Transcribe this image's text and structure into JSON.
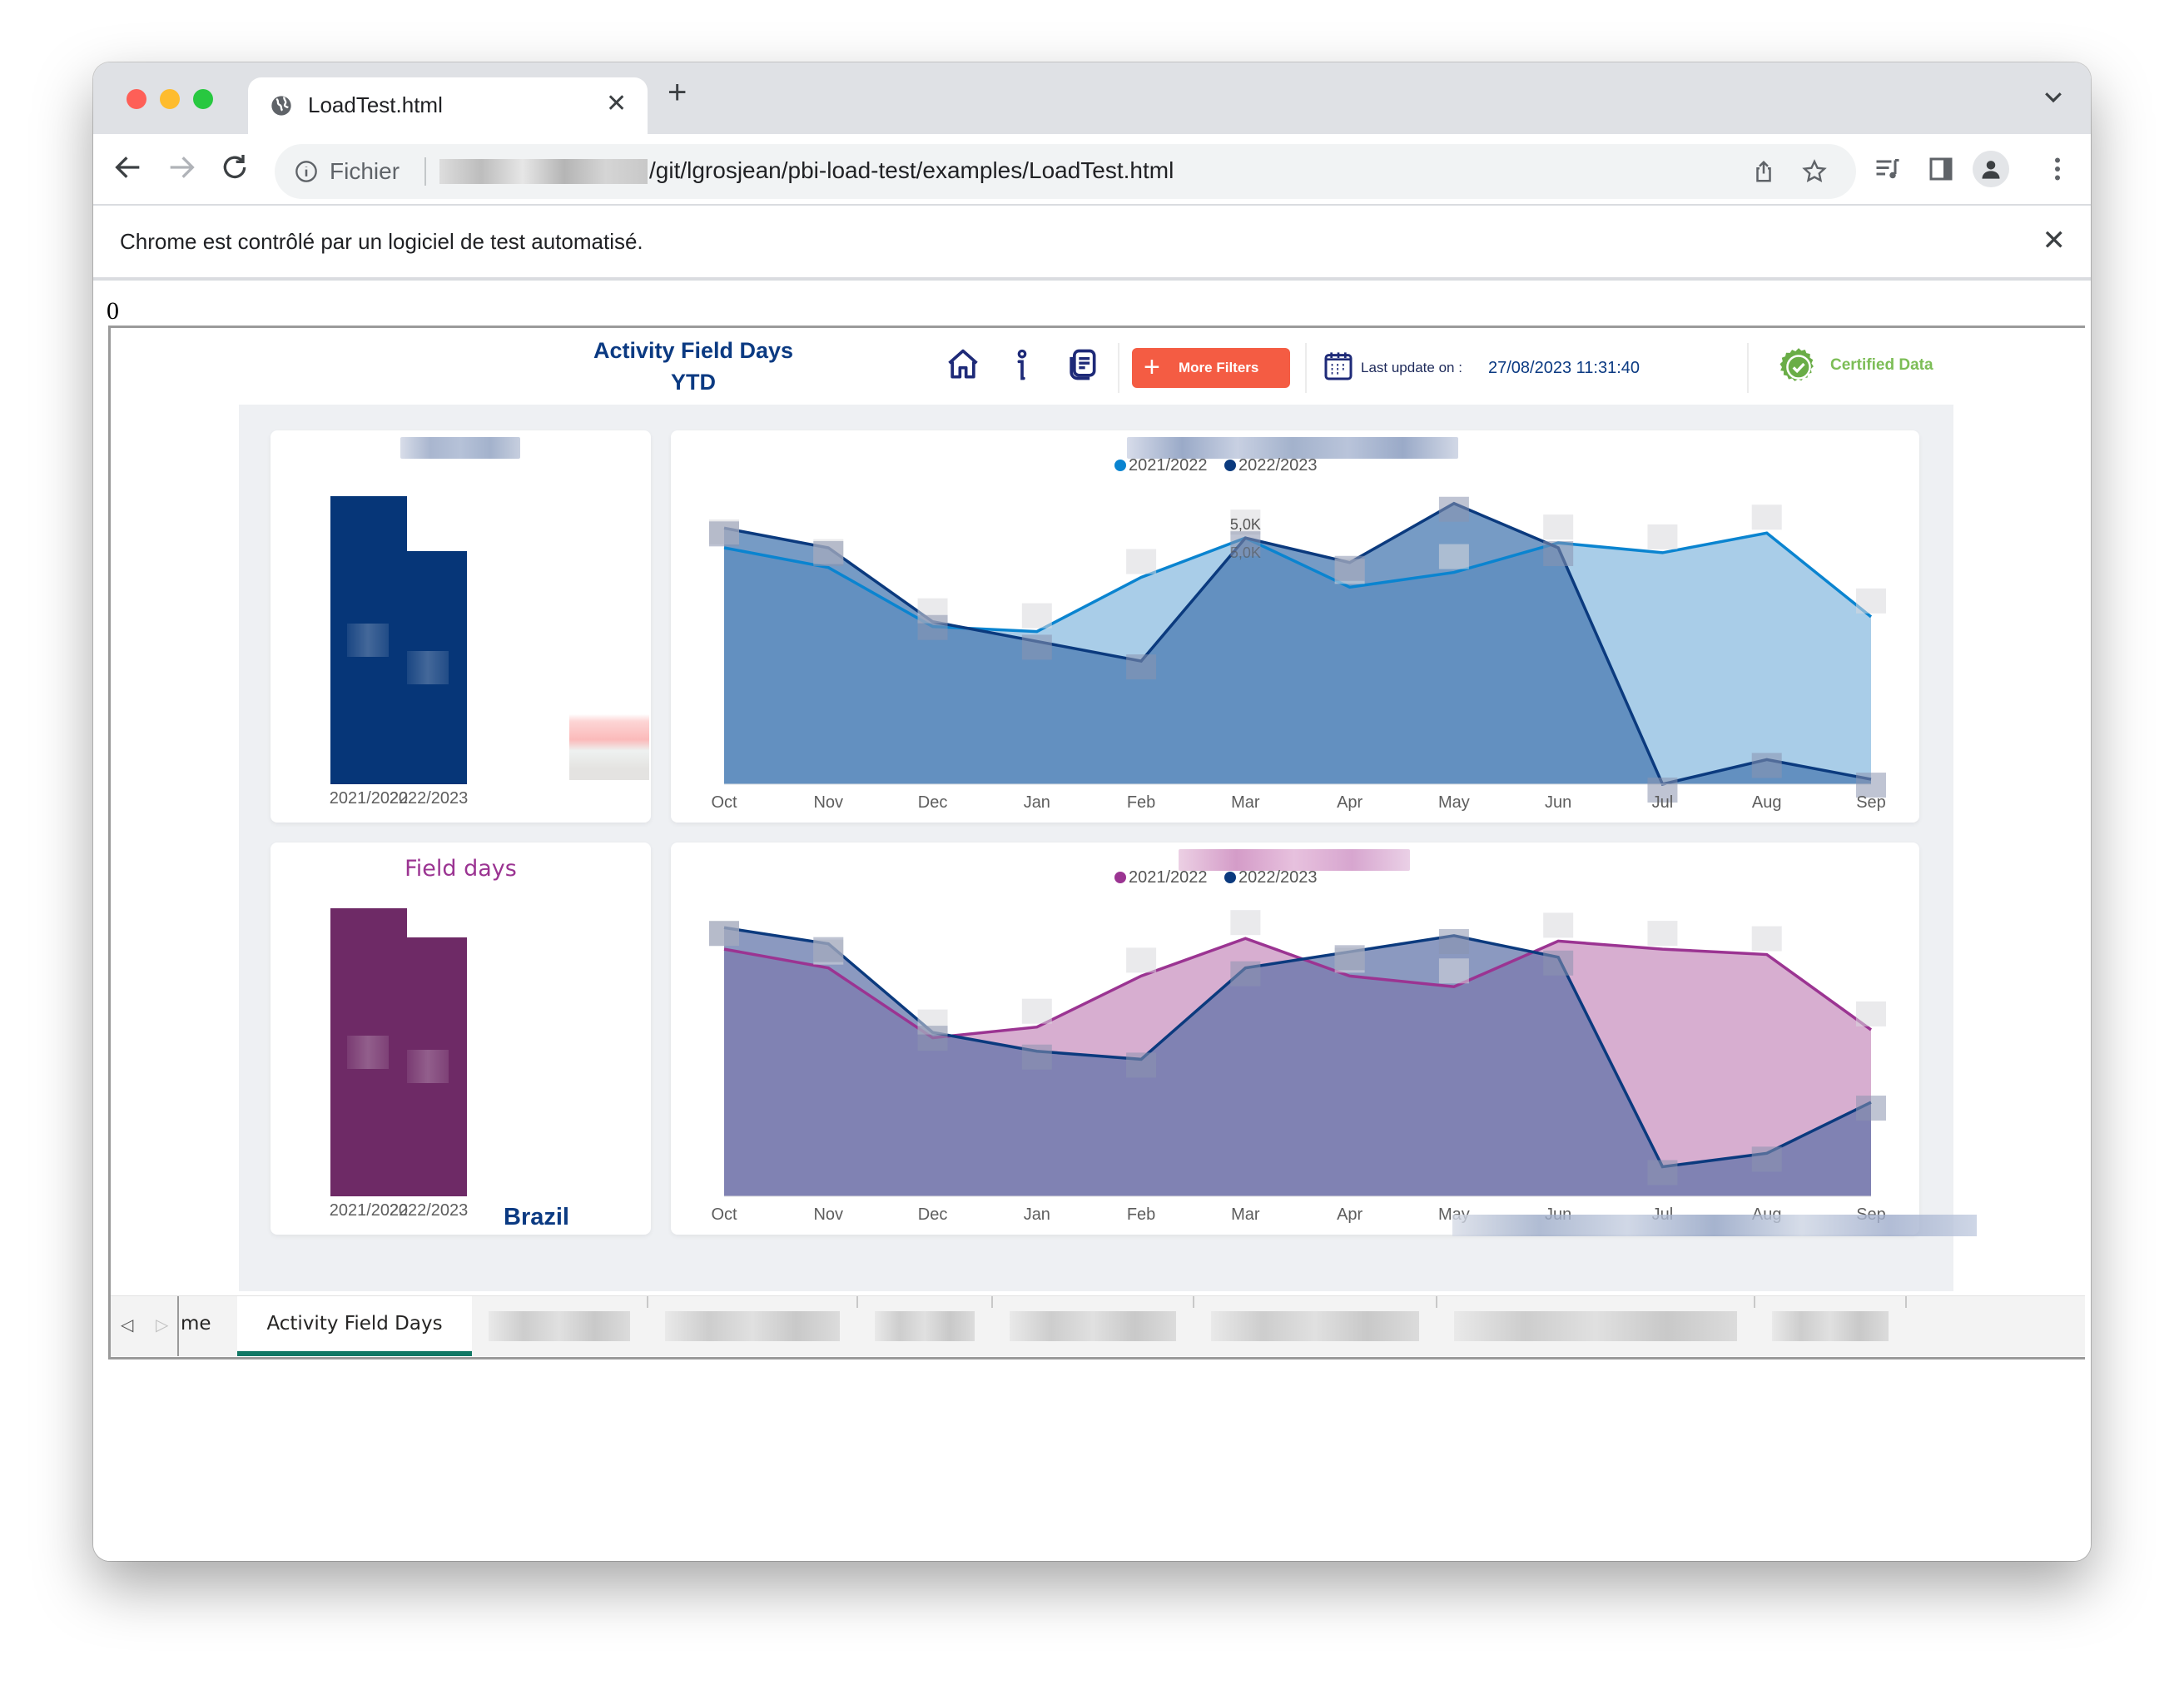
{
  "browser": {
    "tab_title": "LoadTest.html",
    "new_tab_symbol": "+",
    "close_symbol": "✕",
    "scheme_label": "Fichier",
    "url_visible": "/git/lgrosjean/pbi-load-test/examples/LoadTest.html",
    "infobar_message": "Chrome est contrôlé par un logiciel de test automatisé."
  },
  "page": {
    "counter_text": "0"
  },
  "report": {
    "title_line1": "Activity Field Days",
    "title_line2": "YTD",
    "header_icons": [
      "home-icon",
      "info-icon",
      "documents-icon"
    ],
    "more_filters_label": "More Filters",
    "last_update_label": "Last update on :",
    "last_update_value": "27/08/2023 11:31:40",
    "certified_label": "Certified Data",
    "region_label": "Brazil",
    "colors": {
      "brand_navy": "#0b3a82",
      "filters_button": "#f45c43",
      "certified_green": "#7cbd56",
      "active_tab_underline": "#117865",
      "activity_bar": "#063678",
      "field_days_bar": "#6e2a66",
      "series_2021_activity": "#0a84d0",
      "series_2022_activity": "#0b3a7e",
      "series_2021_field": "#9b3492",
      "series_2022_field": "#0b3a7e"
    }
  },
  "chart_data": [
    {
      "type": "bar",
      "title": "",
      "categories": [
        "2021/2022",
        "2022/2023"
      ],
      "values": [
        100,
        81
      ],
      "value_units": "relative index (labels obscured)",
      "color": "#063678"
    },
    {
      "type": "area",
      "title": "",
      "categories": [
        "Oct",
        "Nov",
        "Dec",
        "Jan",
        "Feb",
        "Mar",
        "Apr",
        "May",
        "Jun",
        "Jul",
        "Aug",
        "Sep"
      ],
      "series": [
        {
          "name": "2021/2022",
          "values": [
            4800,
            4400,
            3200,
            3100,
            4200,
            5000,
            4000,
            4300,
            4900,
            4700,
            5100,
            3400
          ]
        },
        {
          "name": "2022/2023",
          "values": [
            5200,
            4800,
            3300,
            2900,
            2500,
            5000,
            4500,
            5700,
            4800,
            0,
            500,
            100
          ]
        }
      ],
      "visible_data_labels": [
        {
          "category": "Mar",
          "series": "2022/2023",
          "text": "5,0K"
        },
        {
          "category": "Mar",
          "series": "2021/2022",
          "text": "5,0K"
        }
      ],
      "legend": [
        "2021/2022",
        "2022/2023"
      ],
      "legend_position": "top-center",
      "ylim": [
        0,
        6000
      ],
      "grid": false
    },
    {
      "type": "bar",
      "title": "Field days",
      "categories": [
        "2021/2022",
        "2022/2023"
      ],
      "values": [
        100,
        90
      ],
      "value_units": "relative index (labels obscured)",
      "color": "#6e2a66"
    },
    {
      "type": "area",
      "title": "",
      "categories": [
        "Oct",
        "Nov",
        "Dec",
        "Jan",
        "Feb",
        "Mar",
        "Apr",
        "May",
        "Jun",
        "Jul",
        "Aug",
        "Sep"
      ],
      "series": [
        {
          "name": "2021/2022",
          "values": [
            92,
            85,
            59,
            63,
            82,
            96,
            82,
            78,
            95,
            92,
            90,
            62
          ]
        },
        {
          "name": "2022/2023",
          "values": [
            100,
            94,
            61,
            54,
            51,
            85,
            91,
            97,
            89,
            11,
            16,
            35
          ]
        }
      ],
      "value_units": "relative index (labels obscured)",
      "legend": [
        "2021/2022",
        "2022/2023"
      ],
      "legend_position": "top-center",
      "ylim": [
        0,
        110
      ],
      "grid": false
    }
  ],
  "page_tabs": {
    "prev_symbol": "◁",
    "next_symbol": "▷",
    "partial_tab_label": "me",
    "active_tab_label": "Activity Field Days",
    "obscured_tab_count": 7
  }
}
